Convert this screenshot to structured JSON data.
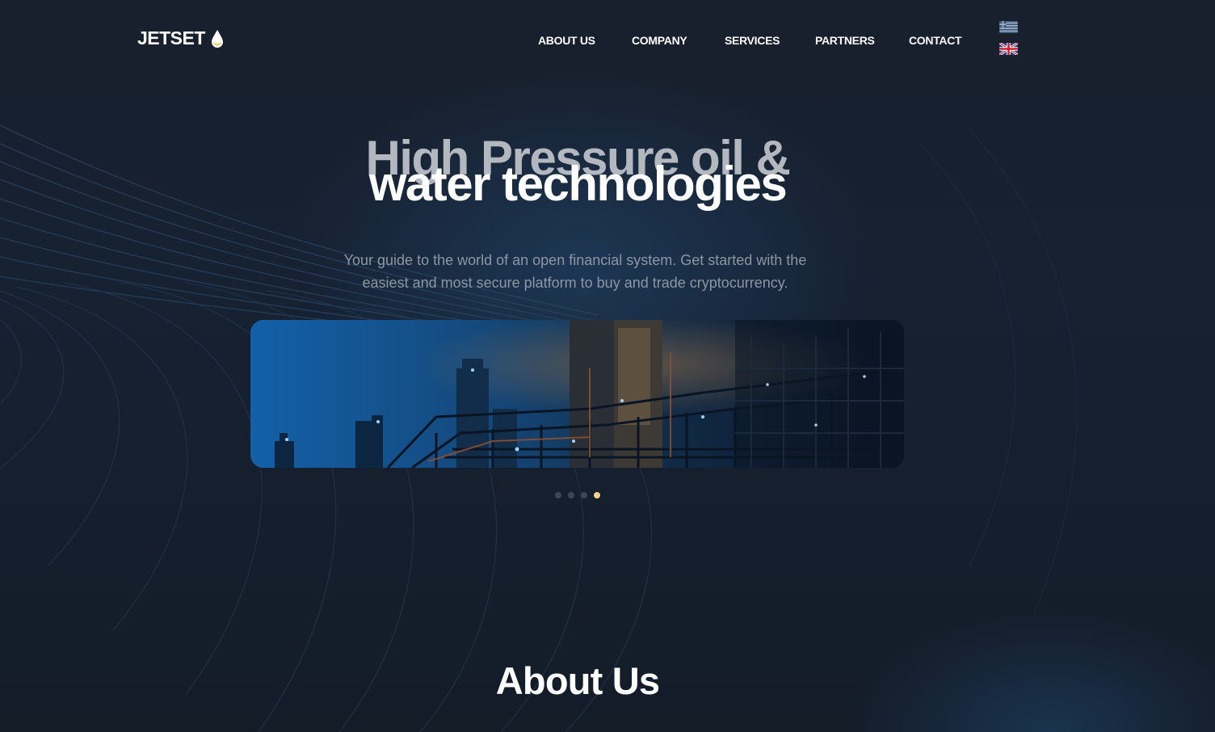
{
  "header": {
    "logo_text": "JETSET",
    "logo_icon": "oil-drop-icon",
    "nav": [
      {
        "label": "ABOUT US"
      },
      {
        "label": "COMPANY"
      },
      {
        "label": "SERVICES"
      },
      {
        "label": "PARTNERS"
      },
      {
        "label": "CONTACT"
      }
    ],
    "languages": [
      {
        "icon": "greek-flag-icon"
      },
      {
        "icon": "uk-flag-icon"
      }
    ]
  },
  "hero": {
    "title_back": "High Pressure oil &",
    "title_front": "water technologies",
    "subtitle": "Your guide to the world of an open financial system. Get started with the easiest and most secure platform to buy and trade cryptocurrency.",
    "slider": {
      "slide_count": 4,
      "active_slide": 4
    }
  },
  "about": {
    "title": "About Us"
  },
  "colors": {
    "background": "#141b26",
    "accent": "#f4d28a",
    "text_primary": "#ffffff",
    "text_muted": "#8d96a3"
  }
}
